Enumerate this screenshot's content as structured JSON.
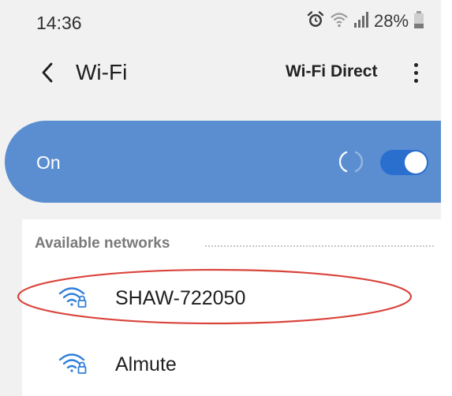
{
  "status_bar": {
    "time": "14:36",
    "battery_percent": "28%",
    "icons": [
      "alarm-icon",
      "wifi-signal-icon",
      "cellular-signal-icon",
      "battery-icon"
    ]
  },
  "app_bar": {
    "title": "Wi-Fi",
    "wifi_direct_label": "Wi-Fi Direct",
    "back_icon": "chevron-left-icon",
    "more_icon": "more-vertical-icon"
  },
  "wifi_toggle": {
    "label": "On",
    "enabled": true,
    "scanning": true
  },
  "networks": {
    "section_title": "Available networks",
    "items": [
      {
        "name": "SHAW-722050",
        "secured": true,
        "highlighted": true
      },
      {
        "name": "Almute",
        "secured": true,
        "highlighted": false
      }
    ]
  },
  "colors": {
    "accent_blue": "#5b8ed0",
    "switch_blue": "#2a6fce",
    "wifi_icon_blue": "#2f7fd9",
    "annotation_red": "#d9443b",
    "background": "#f1f1f1"
  }
}
